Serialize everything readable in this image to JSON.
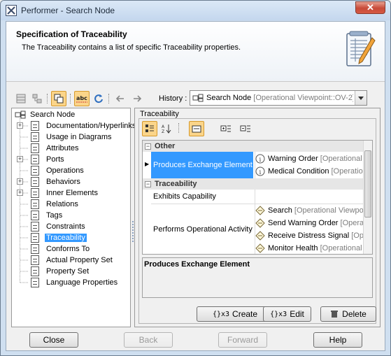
{
  "window": {
    "title": "Performer - Search Node",
    "close_glyph": "✕"
  },
  "header": {
    "title": "Specification of Traceability",
    "description": "The Traceability contains a list of specific Traceability properties."
  },
  "toolbar": {
    "history_label": "History :",
    "history_value": "Search Node",
    "history_value_detail": "[Operational Viewpoint::OV-2]"
  },
  "tree": {
    "root": "Search Node",
    "items": [
      {
        "label": "Documentation/Hyperlinks",
        "expandable": true
      },
      {
        "label": "Usage in Diagrams",
        "expandable": false
      },
      {
        "label": "Attributes",
        "expandable": false
      },
      {
        "label": "Ports",
        "expandable": true
      },
      {
        "label": "Operations",
        "expandable": false
      },
      {
        "label": "Behaviors",
        "expandable": true
      },
      {
        "label": "Inner Elements",
        "expandable": true
      },
      {
        "label": "Relations",
        "expandable": false
      },
      {
        "label": "Tags",
        "expandable": false
      },
      {
        "label": "Constraints",
        "expandable": false
      },
      {
        "label": "Traceability",
        "expandable": false,
        "selected": true
      },
      {
        "label": "Conforms To",
        "expandable": false
      },
      {
        "label": "Actual Property Set",
        "expandable": false
      },
      {
        "label": "Property Set",
        "expandable": false
      },
      {
        "label": "Language Properties",
        "expandable": false
      }
    ]
  },
  "panel": {
    "title": "Traceability",
    "groups": [
      {
        "name": "Other",
        "rows": [
          {
            "name": "Produces Exchange Element",
            "selected": true,
            "values": [
              {
                "icon": "info-icon",
                "label": "Warning Order",
                "detail": "[Operational"
              },
              {
                "icon": "info-icon",
                "label": "Medical Condition",
                "detail": "[Operation"
              }
            ]
          }
        ]
      },
      {
        "name": "Traceability",
        "rows": [
          {
            "name": "Exhibits Capability",
            "selected": false,
            "values": []
          },
          {
            "name": "Performs Operational Activity",
            "selected": false,
            "values": [
              {
                "icon": "activity-icon",
                "label": "Search",
                "detail": "[Operational Viewpoi"
              },
              {
                "icon": "activity-icon",
                "label": "Send Warning Order",
                "detail": "[Operat"
              },
              {
                "icon": "activity-icon",
                "label": "Receive Distress Signal",
                "detail": "[Ope"
              },
              {
                "icon": "activity-icon",
                "label": "Monitor Health",
                "detail": "[Operational V"
              }
            ]
          }
        ]
      }
    ],
    "description_title": "Produces Exchange Element",
    "buttons": {
      "create": "Create",
      "edit": "Edit",
      "delete": "Delete"
    },
    "button_icon_text": "{}x3"
  },
  "footer": {
    "close": "Close",
    "back": "Back",
    "forward": "Forward",
    "help": "Help"
  },
  "colors": {
    "selection": "#3399ff",
    "active_tool": "#fbd58a",
    "titlebar": "#c4d7ee"
  }
}
